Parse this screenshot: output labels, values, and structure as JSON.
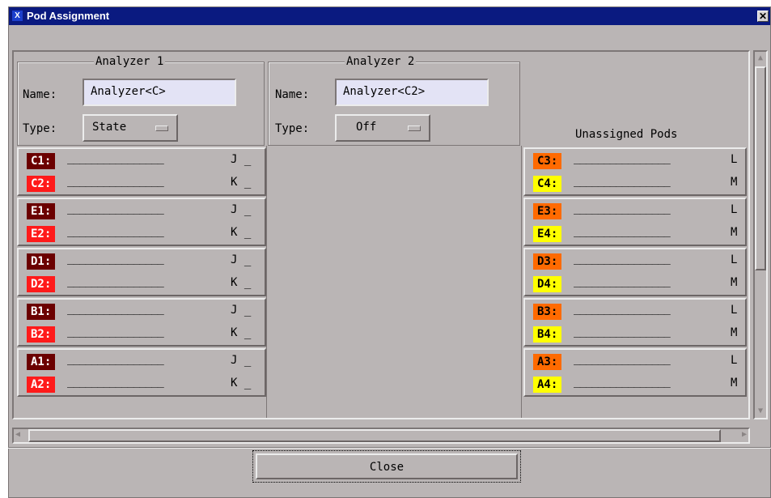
{
  "window": {
    "title": "Pod Assignment",
    "app_icon": "X",
    "close_glyph": "✕"
  },
  "analyzer1": {
    "title": "Analyzer 1",
    "name_label": "Name:",
    "name_value": "Analyzer<C>",
    "type_label": "Type:",
    "type_value": "State",
    "pods": [
      {
        "a": "C1:",
        "b": "C2:",
        "la": "J _",
        "lb": "K _"
      },
      {
        "a": "E1:",
        "b": "E2:",
        "la": "J _",
        "lb": "K _"
      },
      {
        "a": "D1:",
        "b": "D2:",
        "la": "J _",
        "lb": "K _"
      },
      {
        "a": "B1:",
        "b": "B2:",
        "la": "J _",
        "lb": "K _"
      },
      {
        "a": "A1:",
        "b": "A2:",
        "la": "J _",
        "lb": "K _"
      }
    ]
  },
  "analyzer2": {
    "title": "Analyzer 2",
    "name_label": "Name:",
    "name_value": "Analyzer<C2>",
    "type_label": "Type:",
    "type_value": "Off"
  },
  "unassigned": {
    "title": "Unassigned Pods",
    "pods": [
      {
        "a": "C3:",
        "b": "C4:",
        "la": "L",
        "lb": "M"
      },
      {
        "a": "E3:",
        "b": "E4:",
        "la": "L",
        "lb": "M"
      },
      {
        "a": "D3:",
        "b": "D4:",
        "la": "L",
        "lb": "M"
      },
      {
        "a": "B3:",
        "b": "B4:",
        "la": "L",
        "lb": "M"
      },
      {
        "a": "A3:",
        "b": "A4:",
        "la": "L",
        "lb": "M"
      }
    ]
  },
  "dashes": "________________",
  "close_label": "Close",
  "colors": {
    "pod1": "#6b0000",
    "pod2": "#ff1a1a",
    "pod3": "#ff6a00",
    "pod4": "#ffff00",
    "titlebar": "#0a1a80",
    "panel": "#bab5b5",
    "field": "#e3e3f5"
  },
  "icons": {
    "scroll_up": "▲",
    "scroll_down": "▼",
    "scroll_left": "◀",
    "scroll_right": "▶"
  }
}
